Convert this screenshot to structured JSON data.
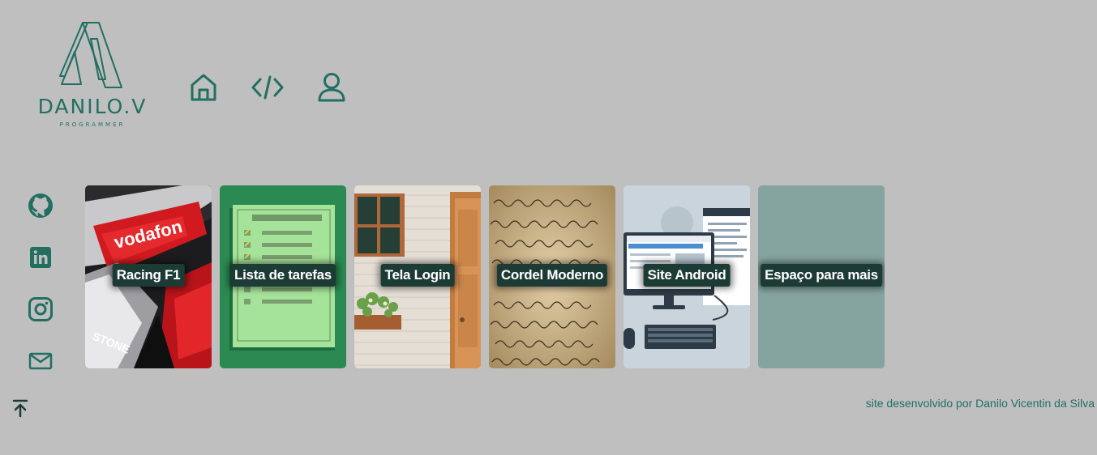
{
  "logo": {
    "name": "DANILO.V",
    "subtitle": "PROGRAMMER"
  },
  "nav": [
    {
      "icon": "home-icon"
    },
    {
      "icon": "code-icon"
    },
    {
      "icon": "user-icon"
    }
  ],
  "social": [
    {
      "icon": "github-icon"
    },
    {
      "icon": "linkedin-icon"
    },
    {
      "icon": "instagram-icon"
    },
    {
      "icon": "mail-icon"
    }
  ],
  "projects": [
    {
      "label": "Racing F1"
    },
    {
      "label": "Lista de tarefas"
    },
    {
      "label": "Tela Login"
    },
    {
      "label": "Cordel Moderno"
    },
    {
      "label": "Site Android"
    },
    {
      "label": "Espaço para mais"
    }
  ],
  "footer": {
    "credit": "site desenvolvido por Danilo Vicentin da Silva"
  },
  "colors": {
    "background": "#bfbfbf",
    "accent": "#226f62",
    "label_bg": "#1d3b35"
  }
}
